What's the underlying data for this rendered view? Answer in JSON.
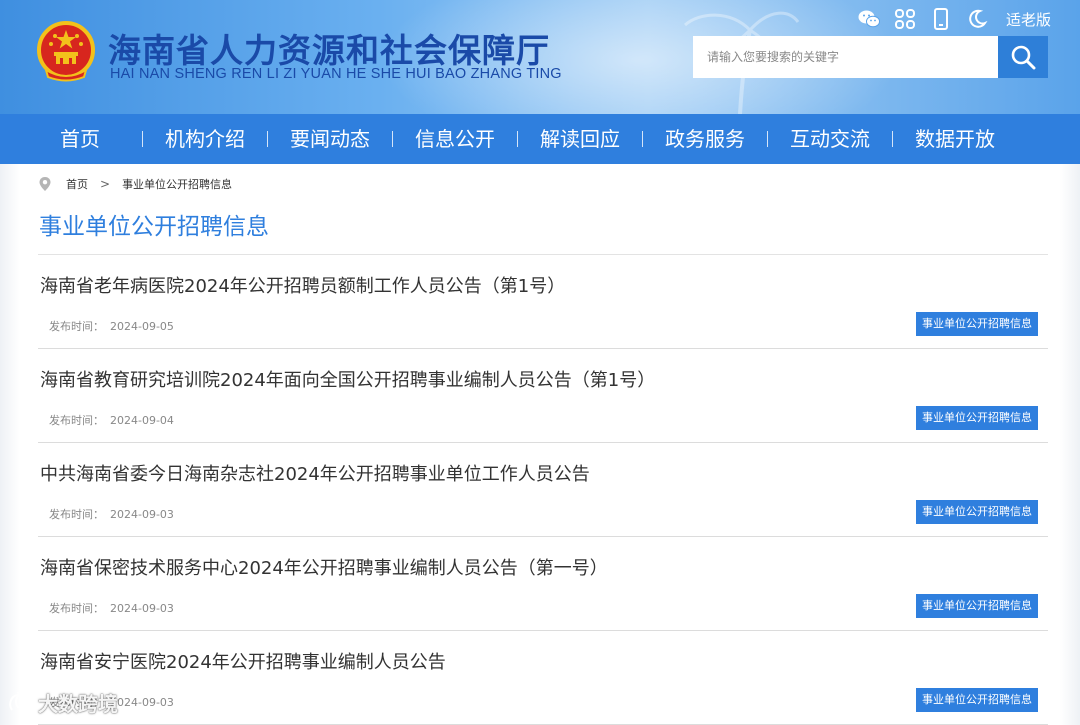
{
  "header": {
    "title": "海南省人力资源和社会保障厅",
    "subtitle": "HAI NAN SHENG REN LI ZI YUAN HE SHE HUI BAO ZHANG TING",
    "tools": {
      "wechat_icon": "wechat-icon",
      "grid_icon": "apps-grid-icon",
      "mobile_icon": "mobile-icon",
      "night_icon": "moon-icon",
      "elder_mode_label": "适老版"
    },
    "search": {
      "placeholder": "请输入您要搜索的关键字"
    }
  },
  "nav": {
    "items": [
      {
        "label": "首页"
      },
      {
        "label": "机构介绍"
      },
      {
        "label": "要闻动态"
      },
      {
        "label": "信息公开"
      },
      {
        "label": "解读回应"
      },
      {
        "label": "政务服务"
      },
      {
        "label": "互动交流"
      },
      {
        "label": "数据开放"
      }
    ]
  },
  "breadcrumb": {
    "home": "首页",
    "separator": ">",
    "current": "事业单位公开招聘信息"
  },
  "section": {
    "title": "事业单位公开招聘信息"
  },
  "list": {
    "date_label": "发布时间：",
    "items": [
      {
        "title": "海南省老年病医院2024年公开招聘员额制工作人员公告（第1号）",
        "date": "2024-09-05",
        "tag": "事业单位公开招聘信息"
      },
      {
        "title": "海南省教育研究培训院2024年面向全国公开招聘事业编制人员公告（第1号）",
        "date": "2024-09-04",
        "tag": "事业单位公开招聘信息"
      },
      {
        "title": "中共海南省委今日海南杂志社2024年公开招聘事业单位工作人员公告",
        "date": "2024-09-03",
        "tag": "事业单位公开招聘信息"
      },
      {
        "title": "海南省保密技术服务中心2024年公开招聘事业编制人员公告（第一号）",
        "date": "2024-09-03",
        "tag": "事业单位公开招聘信息"
      },
      {
        "title": "海南省安宁医院2024年公开招聘事业编制人员公告",
        "date": "2024-09-03",
        "tag": "事业单位公开招聘信息"
      }
    ]
  },
  "watermark": {
    "text": "大数跨境"
  },
  "colors": {
    "brand_blue": "#2f7fde",
    "title_blue": "#1a4aa8",
    "text_dark": "#333333",
    "text_muted": "#888888"
  }
}
